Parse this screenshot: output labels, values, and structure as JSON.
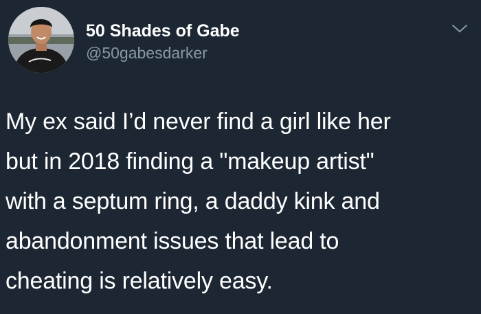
{
  "author": {
    "display_name": "50 Shades of Gabe",
    "handle": "@50gabesdarker",
    "avatar_icon": "profile-photo"
  },
  "menu": {
    "icon": "chevron-down-icon"
  },
  "tweet": {
    "lines": [
      "My ex said I’d never find a girl like her",
      "but in 2018 finding a \"makeup artist\"",
      "with a septum ring, a daddy kink and",
      "abandonment issues that lead to",
      "cheating is relatively easy."
    ]
  },
  "colors": {
    "background": "#1c2733",
    "text": "#ffffff",
    "secondary": "#8899a6"
  }
}
